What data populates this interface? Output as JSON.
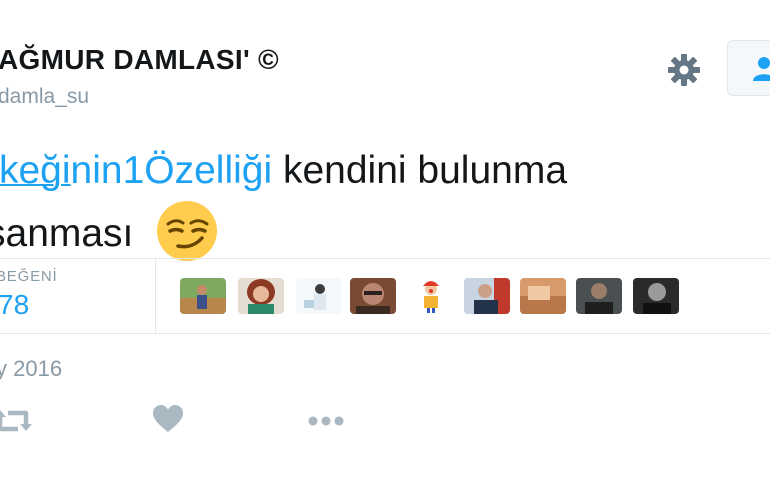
{
  "profile": {
    "display_name": "AĞMUR DAMLASI' ©",
    "username": "damla_su"
  },
  "header": {
    "settings_icon": "gear-icon",
    "follow_icon": "add-user-icon"
  },
  "tweet": {
    "hashtag_underlined": "rkeği",
    "hashtag_rest": "nin1Özelliği",
    "line1_rest": " kendini bulunma",
    "line2": " sanması",
    "emoji": "smirking-face-emoji"
  },
  "stats": {
    "likes_label": "BEĞENİ",
    "likes_count": "78",
    "avatars_count_visible": 9
  },
  "meta": {
    "date": "y 2016"
  },
  "actions": {
    "icons": [
      "retweet-icon",
      "heart-icon",
      "more-icon"
    ]
  },
  "colors": {
    "accent": "#1da1f2",
    "text": "#14171a",
    "muted": "#8899a6",
    "border": "#e1e8ed"
  }
}
